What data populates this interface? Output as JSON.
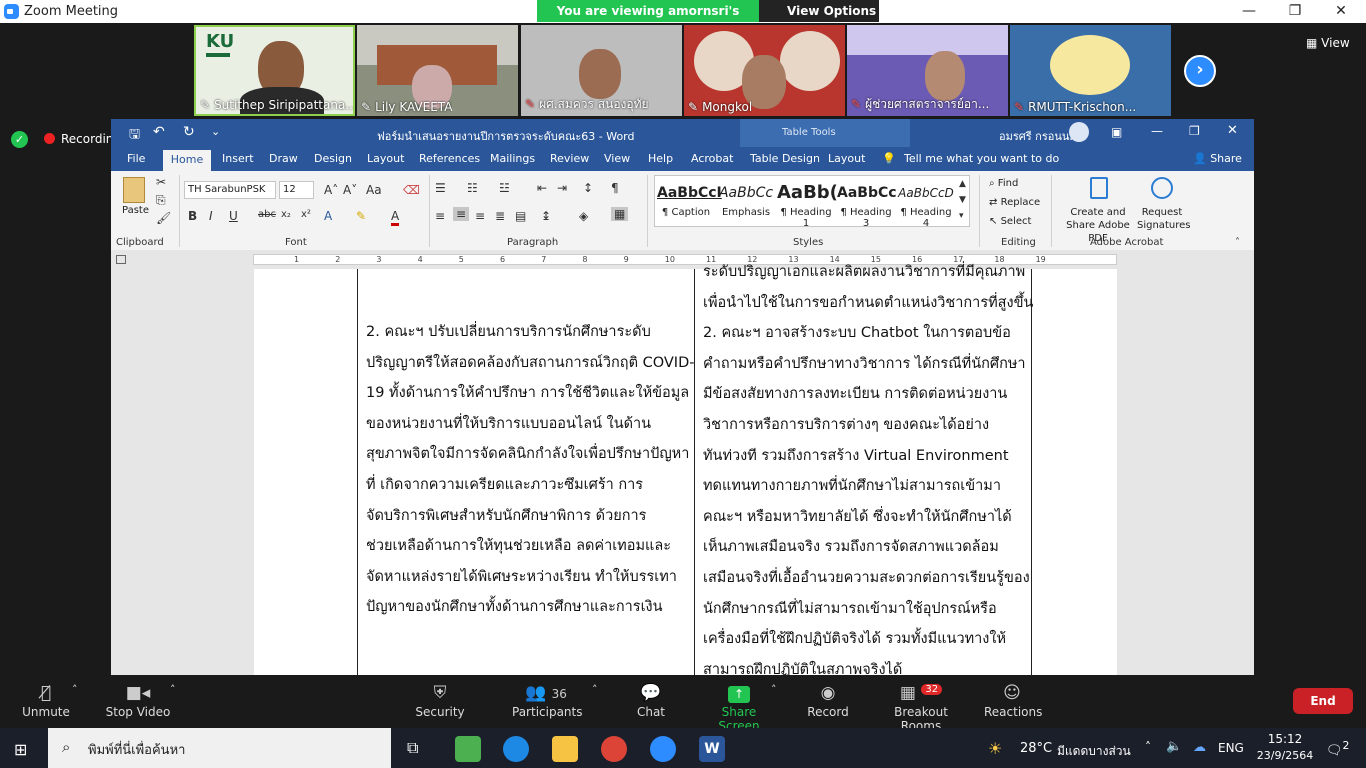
{
  "zoom": {
    "window_title": "Zoom Meeting",
    "banner": "You are viewing amornsri's screen",
    "view_options": "View Options",
    "view_label": "View",
    "recording": "Recording",
    "participants_tiles": [
      {
        "name": "Sutithep Siripipattana..."
      },
      {
        "name": "Lily KAVEETA"
      },
      {
        "name": "ผศ.สมควร  สนองอุทัย"
      },
      {
        "name": "Mongkol"
      },
      {
        "name": "ผู้ช่วยศาสตราจารย์อา..."
      },
      {
        "name": "RMUTT-Krischon..."
      }
    ],
    "tile1_logo": "KU",
    "controls": {
      "unmute": "Unmute",
      "stop_video": "Stop Video",
      "security": "Security",
      "participants": "Participants",
      "participants_count": "36",
      "chat": "Chat",
      "share_screen": "Share Screen",
      "record": "Record",
      "breakout": "Breakout Rooms",
      "breakout_badge": "32",
      "reactions": "Reactions",
      "end": "End"
    }
  },
  "word": {
    "title": "ฟอร์มนำเสนอรายงานปีการตรวจระดับคณะ63 - Word",
    "table_tools": "Table Tools",
    "user": "อมรศรี กรอนนม",
    "tabs": [
      "File",
      "Home",
      "Insert",
      "Draw",
      "Design",
      "Layout",
      "References",
      "Mailings",
      "Review",
      "View",
      "Help",
      "Acrobat",
      "Table Design",
      "Layout"
    ],
    "tell_me": "Tell me what you want to do",
    "share": "Share",
    "font_name": "TH SarabunPSK",
    "font_size": "12",
    "groups": [
      "Clipboard",
      "Font",
      "Paragraph",
      "Styles",
      "Editing",
      "Adobe Acrobat"
    ],
    "paste": "Paste",
    "styles": [
      {
        "preview": "AaBbCcI",
        "name": "¶ Caption"
      },
      {
        "preview": "AaBbCc",
        "name": "Emphasis"
      },
      {
        "preview": "AaBb(",
        "name": "¶ Heading 1"
      },
      {
        "preview": "AaBbCc",
        "name": "¶ Heading 3"
      },
      {
        "preview": "AaBbCcD",
        "name": "¶ Heading 4"
      }
    ],
    "editing": [
      "Find",
      "Replace",
      "Select"
    ],
    "acrobat": [
      "Create and Share Adobe PDF",
      "Request Signatures"
    ],
    "ruler_numbers": [
      "1",
      "2",
      "3",
      "4",
      "5",
      "6",
      "7",
      "8",
      "9",
      "10",
      "11",
      "12",
      "13",
      "14",
      "15",
      "16",
      "17",
      "18",
      "19"
    ],
    "left_col": [
      "2. คณะฯ ปรับเปลี่ยนการบริการนักศึกษาระดับ",
      "ปริญญาตรีให้สอดคล้องกับสถานการณ์วิกฤติ COVID-",
      "19 ทั้งด้านการให้คำปรึกษา การใช้ชีวิตและให้ข้อมูล",
      "ของหน่วยงานที่ให้บริการแบบออนไลน์ ในด้าน",
      "สุขภาพจิตใจมีการจัดคลินิกกำลังใจเพื่อปรึกษาปัญหา",
      "ที่ เกิดจากความเครียดและภาวะซึมเศร้า การ",
      "จัดบริการพิเศษสำหรับนักศึกษาพิการ ด้วยการ",
      "ช่วยเหลือด้านการให้ทุนช่วยเหลือ ลดค่าเทอมและ",
      "จัดหาแหล่งรายได้พิเศษระหว่างเรียน ทำให้บรรเทา",
      "ปัญหาของนักศึกษาทั้งด้านการศึกษาและการเงิน"
    ],
    "right_col": [
      "ระดับปริญญาเอกและผลิตผลงานวิชาการที่มีคุณภาพ",
      "เพื่อนำไปใช้ในการขอกำหนดตำแหน่งวิชาการที่สูงขึ้น",
      "2. คณะฯ อาจสร้างระบบ Chatbot ในการตอบข้อ",
      "คำถามหรือคำปรึกษาทางวิชาการ ได้กรณีที่นักศึกษา",
      "มีข้อสงสัยทางการลงทะเบียน การติดต่อหน่วยงาน",
      "วิชาการหรือการบริการต่างๆ ของคณะได้อย่าง",
      "ทันท่วงที รวมถึงการสร้าง Virtual Environment",
      "ทดแทนทางกายภาพที่นักศึกษาไม่สามารถเข้ามา",
      "คณะฯ หรือมหาวิทยาลัยได้ ซึ่งจะทำให้นักศึกษาได้",
      "เห็นภาพเสมือนจริง รวมถึงการจัดสภาพแวดล้อม",
      "เสมือนจริงที่เอื้ออำนวยความสะดวกต่อการเรียนรู้ของ",
      "นักศึกษากรณีที่ไม่สามารถเข้ามาใช้อุปกรณ์หรือ",
      "เครื่องมือที่ใช้ฝึกปฏิบัติจริงได้ รวมทั้งมีแนวทางให้",
      "สามารถฝึกปฏิบัติในสภาพจริงได้"
    ]
  },
  "taskbar": {
    "search_placeholder": "พิมพ์ที่นี่เพื่อค้นหา",
    "weather": "28°C",
    "weather_text": "มีแดดบางส่วน",
    "lang": "ENG",
    "time": "15:12",
    "date": "23/9/2564",
    "notifications": "2"
  },
  "colors": {
    "word_blue": "#2b579a",
    "zoom_green": "#23c552",
    "zoom_blue": "#2d8cff",
    "end_red": "#c92125"
  }
}
